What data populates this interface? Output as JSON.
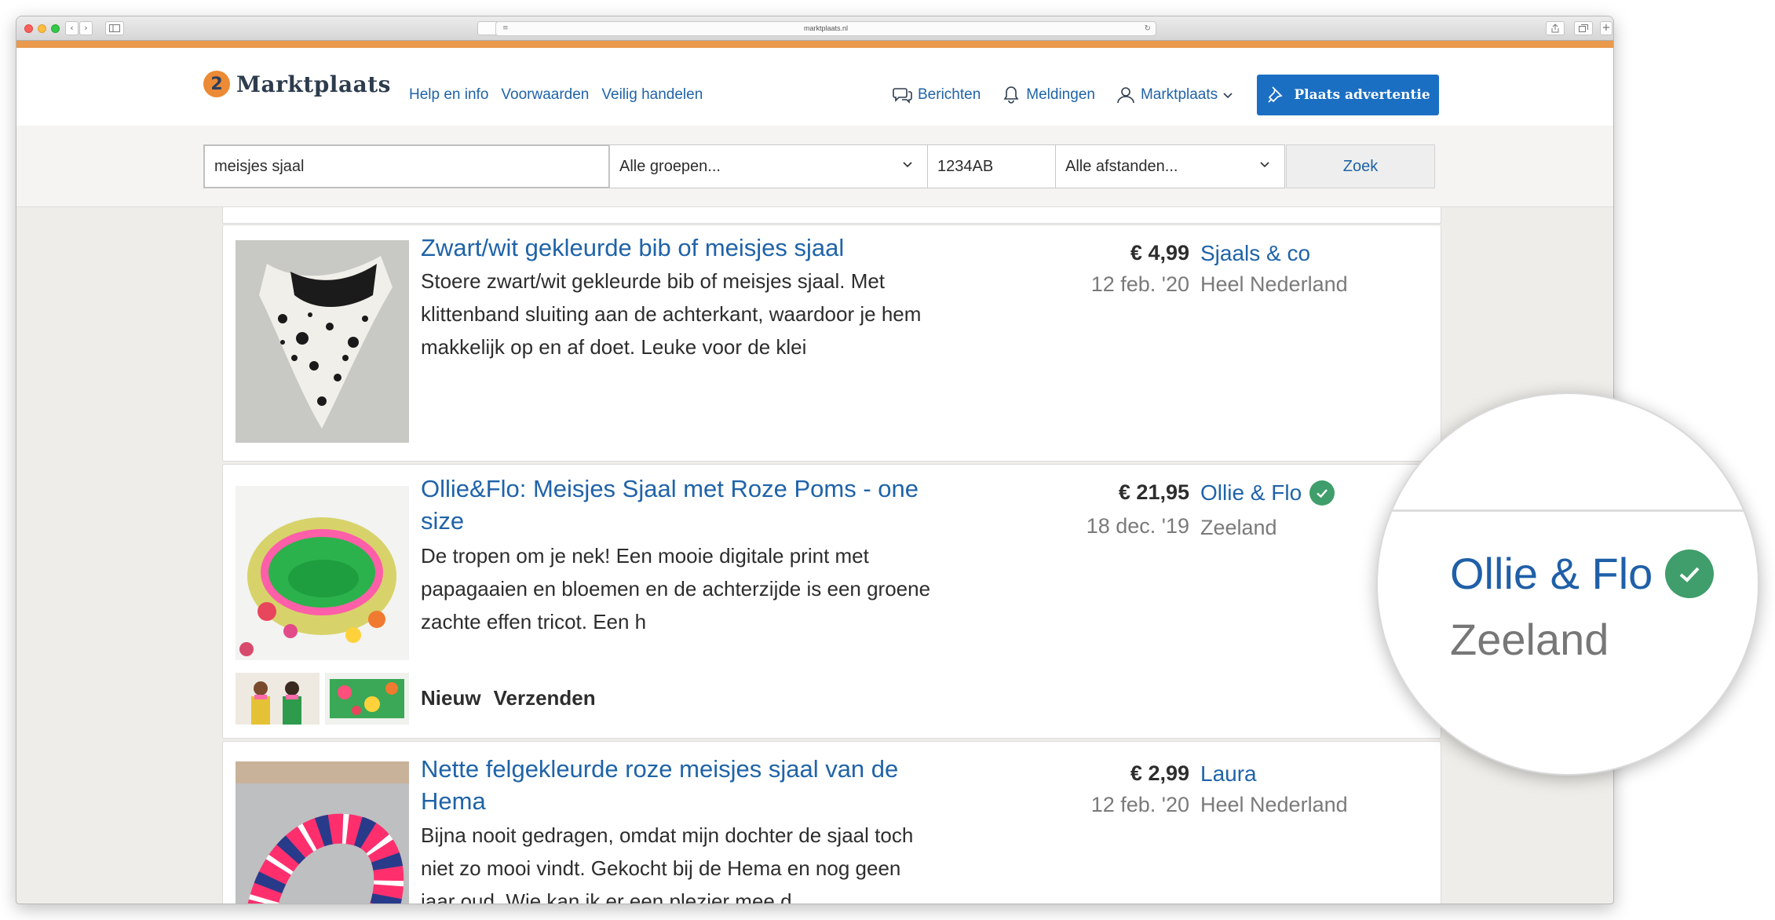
{
  "browser": {
    "url": "marktplaats.nl",
    "back_glyph": "‹",
    "forward_glyph": "›",
    "reload_glyph": "↻",
    "reader_glyph": "≡"
  },
  "header": {
    "logo_mark": "2",
    "logo_text": "Marktplaats",
    "links": [
      "Help en info",
      "Voorwaarden",
      "Veilig handelen"
    ],
    "messages_label": "Berichten",
    "notifications_label": "Meldingen",
    "account_label": "Marktplaats",
    "place_ad_label": "Plaats advertentie",
    "accent_color": "#1b6fc3",
    "brand_color": "#ec8a35"
  },
  "search": {
    "query": "meisjes sjaal",
    "category": "Alle groepen...",
    "postcode": "1234AB",
    "distance": "Alle afstanden...",
    "submit_label": "Zoek"
  },
  "listings": [
    {
      "title": "Zwart/wit gekleurde bib of meisjes sjaal",
      "description": "Stoere zwart/wit gekleurde bib of meisjes sjaal. Met klittenband sluiting aan de achterkant, waardoor je hem makkelijk op en af doet. Leuke voor de klei",
      "price": "€ 4,99",
      "date": "12 feb. '20",
      "seller": "Sjaals & co",
      "location": "Heel Nederland",
      "verified": false
    },
    {
      "title": "Ollie&Flo: Meisjes Sjaal met Roze Poms - one size",
      "description": "De tropen om je nek! Een mooie digitale print met papagaaien en bloemen en de achterzijde is een groene zachte effen tricot. Een h",
      "price": "€ 21,95",
      "date": "18 dec. '19",
      "seller": "Ollie & Flo",
      "location": "Zeeland",
      "verified": true,
      "tags": [
        "Nieuw",
        "Verzenden"
      ]
    },
    {
      "title": "Nette felgekleurde roze meisjes sjaal van de Hema",
      "description": "Bijna nooit gedragen, omdat mijn dochter de sjaal toch niet zo mooi vindt. Gekocht bij de Hema en nog geen jaar oud. Wie kan ik er een plezier mee d",
      "price": "€ 2,99",
      "date": "12 feb. '20",
      "seller": "Laura",
      "location": "Heel Nederland",
      "verified": false
    }
  ],
  "magnifier": {
    "seller": "Ollie & Flo",
    "location": "Zeeland",
    "verified_color": "#3f9e6b"
  },
  "icons": {
    "messages": "chat-bubbles-icon",
    "notifications": "bell-icon",
    "account": "user-icon",
    "place_ad": "pin-icon",
    "verified": "check-circle-icon",
    "dropdown": "chevron-down-icon"
  }
}
